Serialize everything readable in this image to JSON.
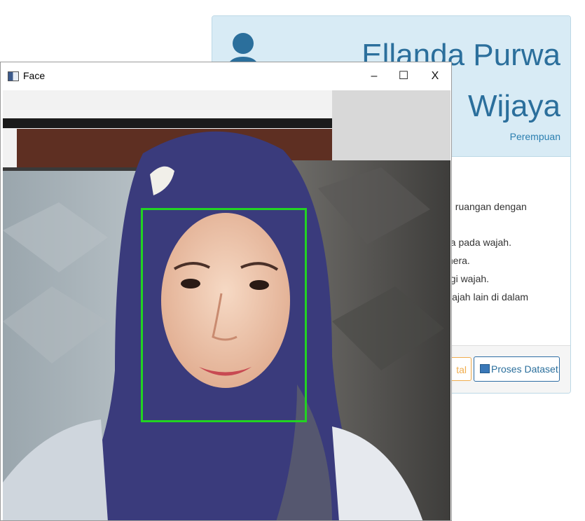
{
  "profile": {
    "name_line1": "Ellanda Purwa",
    "name_line2": "Wijaya",
    "gender": "Perempuan"
  },
  "instructions": {
    "lines": [
      "di ruangan dengan",
      "da pada wajah.",
      "mera.",
      "ngi wajah.",
      "wajah lain di dalam"
    ]
  },
  "footer": {
    "partial_button_label": "tal",
    "proses_button_label": "Proses Dataset"
  },
  "window": {
    "title": "Face",
    "minimize": "–",
    "maximize": "☐",
    "close": "X"
  },
  "colors": {
    "header_bg": "#d8ebf5",
    "name_color": "#2b6f9c",
    "face_box": "#22d322",
    "warning": "#f0ad4e"
  }
}
